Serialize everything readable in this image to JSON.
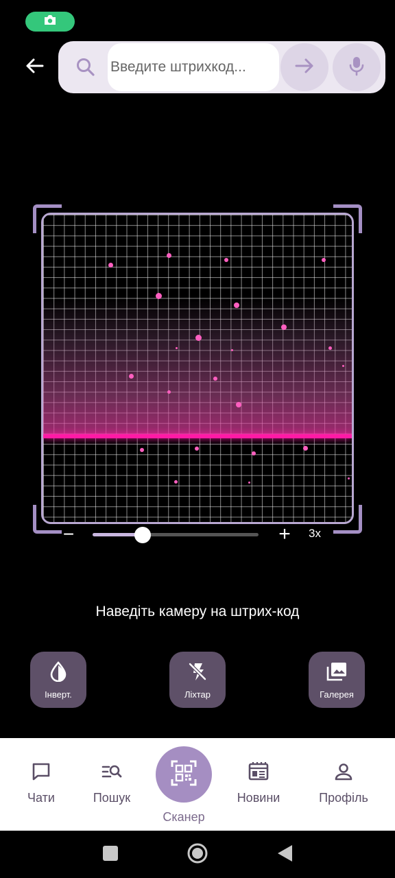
{
  "status_bar": {
    "camera_pill_icon": "camera-icon",
    "pill_color": "#34c77b"
  },
  "header": {
    "back_icon": "arrow-left-icon",
    "search_placeholder": "Введите штрихкод...",
    "search_value": "",
    "search_icon": "search-icon",
    "go_icon": "arrow-right-icon",
    "mic_icon": "microphone-icon"
  },
  "scanner": {
    "laser_color": "#ff1aa6",
    "frame_color": "#a48fc4",
    "zoom": {
      "minus_label": "−",
      "plus_label": "+",
      "level_label": "3x",
      "slider_fraction": 0.3
    },
    "hint": "Наведіть камеру на штрих-код"
  },
  "actions": [
    {
      "label": "Інверт.",
      "icon": "invert-icon"
    },
    {
      "label": "Ліхтар",
      "icon": "flash-off-icon"
    },
    {
      "label": "Галерея",
      "icon": "gallery-icon"
    }
  ],
  "bottom_nav": {
    "chats": "Чати",
    "search": "Пошук",
    "scanner": "Сканер",
    "news": "Новини",
    "profile": "Профіль",
    "accent": "#a58ec2"
  },
  "system_nav": {
    "recents_icon": "square-icon",
    "home_icon": "circle-icon",
    "back_icon": "triangle-back-icon"
  }
}
